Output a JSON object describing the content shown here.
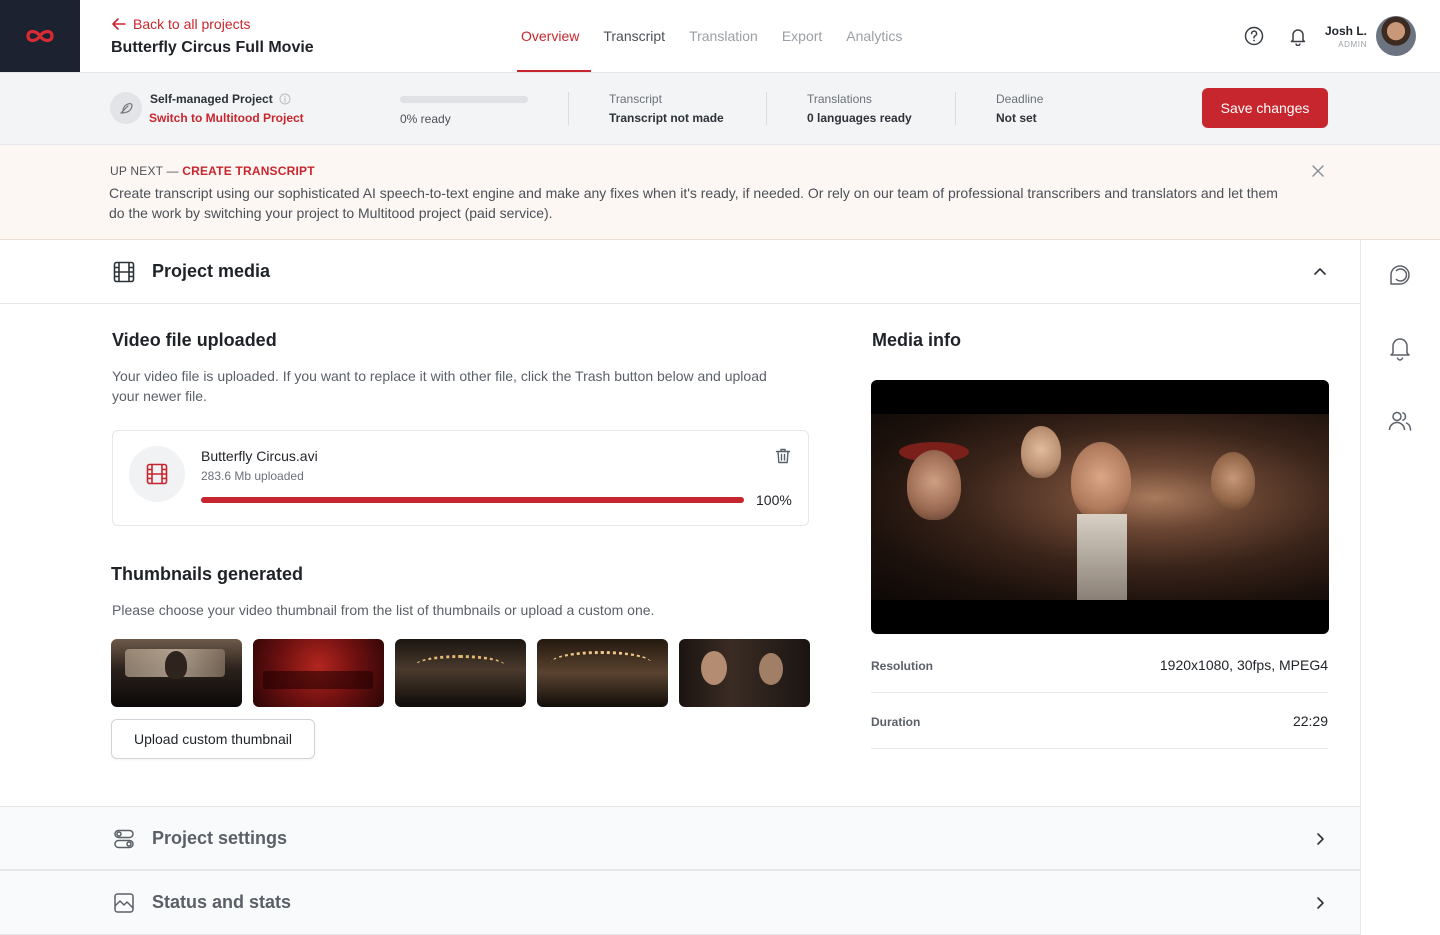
{
  "header": {
    "back_label": "Back to all projects",
    "project_title": "Butterfly Circus Full Movie",
    "tabs": [
      {
        "label": "Overview",
        "state": "active"
      },
      {
        "label": "Transcript",
        "state": "normal"
      },
      {
        "label": "Translation",
        "state": "disabled"
      },
      {
        "label": "Export",
        "state": "disabled"
      },
      {
        "label": "Analytics",
        "state": "disabled"
      }
    ],
    "user": {
      "name": "Josh L.",
      "role": "ADMIN"
    },
    "icons": [
      "help-icon",
      "bell-icon"
    ],
    "brand_color": "#c8262e"
  },
  "statusbar": {
    "project_type": "Self-managed Project",
    "switch_link": "Switch to Multitood Project",
    "progress": {
      "value": 0,
      "label": "0% ready"
    },
    "transcript": {
      "label": "Transcript",
      "value": "Transcript not made"
    },
    "translations": {
      "label": "Translations",
      "value": "0 languages ready"
    },
    "deadline": {
      "label": "Deadline",
      "value": "Not set"
    },
    "save_label": "Save changes"
  },
  "banner": {
    "prefix": "UP NEXT — ",
    "action": "CREATE TRANSCRIPT",
    "text": "Create transcript using our sophisticated AI speech-to-text engine and make any fixes when it's ready, if needed. Or rely on our team of professional transcribers and translators and let them do the work by switching your project to Multitood project (paid service)."
  },
  "project_media": {
    "title": "Project media",
    "video": {
      "title": "Video file uploaded",
      "description": "Your video file is uploaded. If you want to replace it with other file, click the Trash button below and upload your newer file.",
      "file_name": "Butterfly Circus.avi",
      "file_size": "283.6 Mb uploaded",
      "progress": 100,
      "progress_label": "100%"
    },
    "thumbnails": {
      "title": "Thumbnails generated",
      "description": "Please choose your video thumbnail from the list of thumbnails or upload a custom one.",
      "count": 5,
      "upload_label": "Upload custom thumbnail"
    },
    "media_info": {
      "title": "Media info",
      "rows": [
        {
          "label": "Resolution",
          "value": "1920x1080, 30fps, MPEG4"
        },
        {
          "label": "Duration",
          "value": "22:29"
        }
      ]
    }
  },
  "sections": [
    {
      "title": "Project settings",
      "icon": "toggles-icon"
    },
    {
      "title": "Status and stats",
      "icon": "chart-icon"
    }
  ],
  "rail": {
    "icons": [
      "comments-icon",
      "notifications-icon",
      "users-icon"
    ]
  }
}
